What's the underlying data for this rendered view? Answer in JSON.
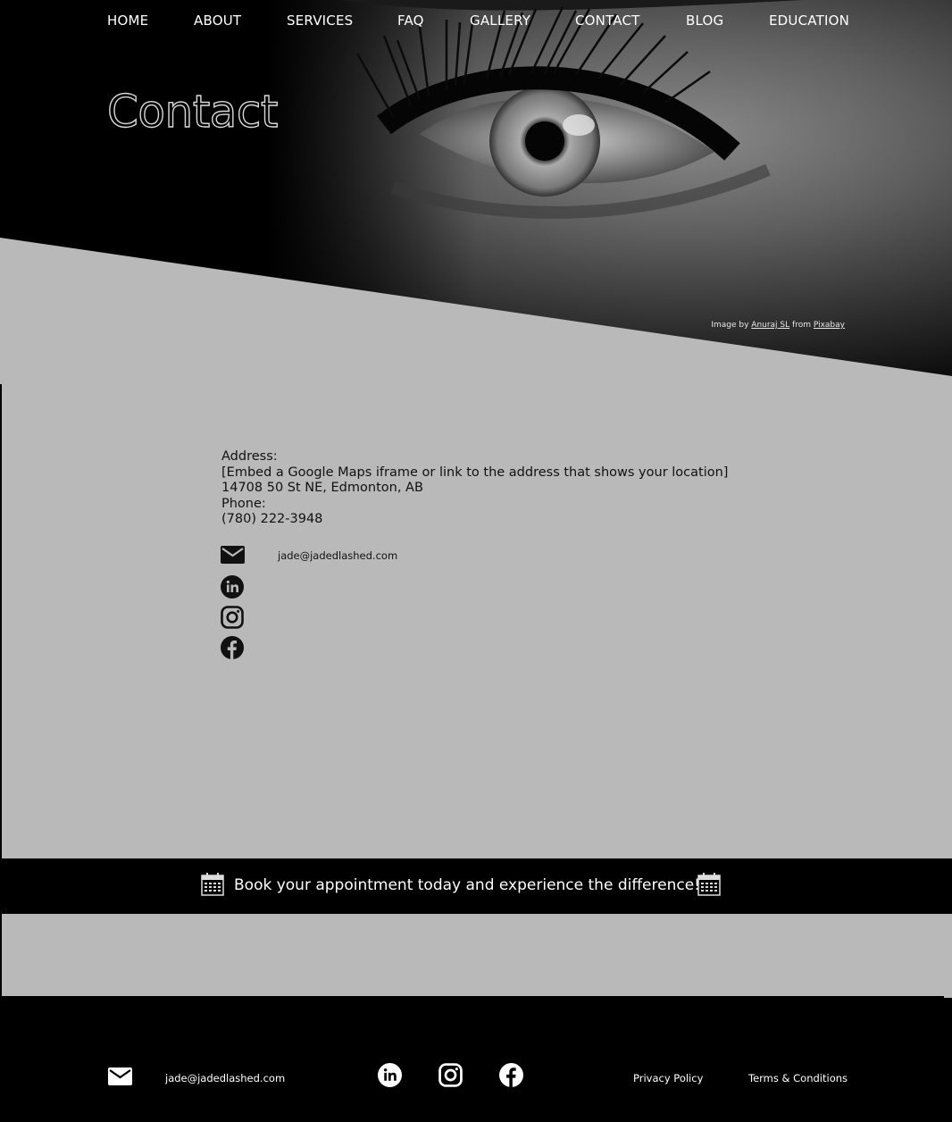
{
  "nav": {
    "items": [
      {
        "label": "HOME"
      },
      {
        "label": "ABOUT"
      },
      {
        "label": "SERVICES"
      },
      {
        "label": "FAQ"
      },
      {
        "label": "GALLERY"
      },
      {
        "label": "CONTACT"
      },
      {
        "label": "BLOG"
      },
      {
        "label": "EDUCATION"
      }
    ]
  },
  "hero": {
    "title": "Contact",
    "credit_prefix": "Image by",
    "credit_author": "Anuraj SL",
    "credit_mid": "from",
    "credit_source": "Pixabay"
  },
  "contact": {
    "address_label": "Address:",
    "address_note": "[Embed a Google Maps iframe or link to the address that shows your location]",
    "address": "14708 50 St NE, Edmonton, AB",
    "phone_label": "Phone:",
    "phone": "(780) 222-3948",
    "email": "jade@jadedlashed.com",
    "icons": [
      "envelope-icon",
      "linkedin-icon",
      "instagram-icon",
      "facebook-icon"
    ]
  },
  "banner": {
    "text": "Book your appointment today and experience the difference!",
    "icons": [
      "calendar-icon",
      "calendar-icon"
    ]
  },
  "footer": {
    "email": "jade@jadedlashed.com",
    "privacy": "Privacy Policy",
    "terms": "Terms & Conditions",
    "icons": [
      "envelope-icon",
      "linkedin-icon",
      "instagram-icon",
      "facebook-icon"
    ]
  },
  "colors": {
    "background": "#000000",
    "content_gray": "#bab9ba",
    "text_dark": "#111111",
    "text_light": "#ffffff"
  }
}
